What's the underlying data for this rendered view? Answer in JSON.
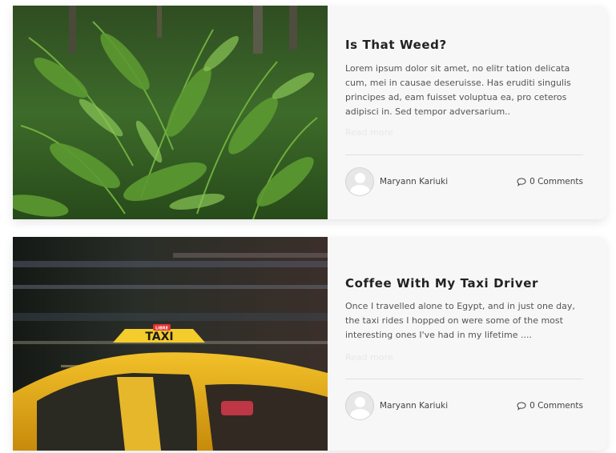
{
  "posts": [
    {
      "title": "Is That Weed?",
      "excerpt": "Lorem ipsum dolor sit amet, no elitr tation delicata cum, mei in causae deseruisse. Has eruditi singulis principes ad, eam fuisset voluptua ea, pro ceteros adipisci in. Sed tempor adversarium..",
      "read_more": "Read more",
      "author": "Maryann Kariuki",
      "comments": "0 Comments",
      "image_icon": "fern-photo"
    },
    {
      "title": "Coffee With My Taxi Driver",
      "excerpt": "Once I travelled alone to Egypt, and in just one day, the taxi rides I hopped on were some of the most interesting ones I've had in my lifetime ....",
      "read_more": "Read more",
      "author": "Maryann Kariuki",
      "comments": "0 Comments",
      "image_icon": "taxi-photo",
      "taxi_sign": "TAXI",
      "taxi_brand": "LIBRE"
    }
  ],
  "colors": {
    "card_bg": "#f7f7f7",
    "title": "#222222",
    "text": "#555555"
  }
}
